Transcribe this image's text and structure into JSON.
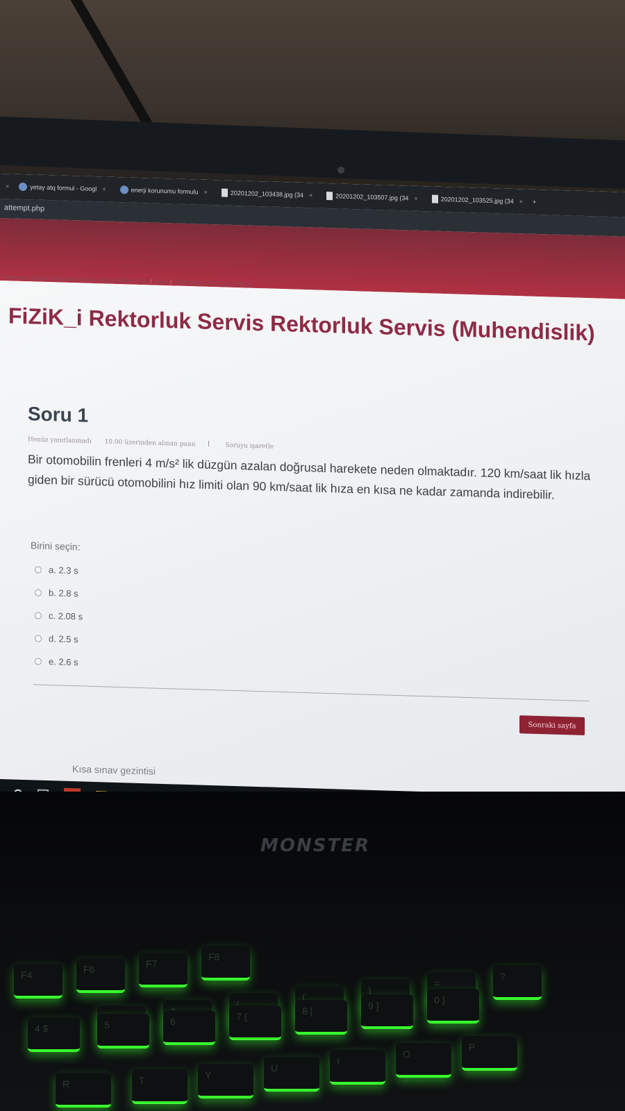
{
  "browser": {
    "tabs": [
      {
        "label": "yetay atq formul - Googl",
        "icon": "google-icon"
      },
      {
        "label": "enerji korunumu formulu",
        "icon": "google-icon"
      },
      {
        "label": "20201202_103438.jpg (34",
        "icon": "file-icon"
      },
      {
        "label": "20201202_103507.jpg (34",
        "icon": "file-icon"
      },
      {
        "label": "20201202_103525.jpg (34",
        "icon": "file-icon"
      }
    ],
    "new_tab_label": "+",
    "url": "attempt.php"
  },
  "page": {
    "breadcrumb": [
      "Rektorluk Servis Rektorluk Servis (Muhendislik) (10)",
      "Giriş",
      "ARASINAV (FIZ111 FIZIK-I)"
    ],
    "breadcrumb_separator": "/",
    "course_title": "FiZiK_i Rektorluk Servis Rektorluk Servis (Muhendislik)"
  },
  "question": {
    "title": "Soru 1",
    "status": "Henüz yanıtlanmadı",
    "points": "10.00 üzerinden alınan puan",
    "flag_label": "Soruyu işaretle",
    "text": "Bir otomobilin frenleri 4 m/s² lik düzgün azalan doğrusal harekete neden olmaktadır. 120 km/saat lik hızla giden bir sürücü otomobilini hız limiti olan 90 km/saat lik hıza en kısa ne kadar zamanda indirebilir.",
    "answer_prompt": "Birini seçin:",
    "options": [
      "a. 2.3 s",
      "b. 2.8 s",
      "c. 2.08 s",
      "d. 2.5 s",
      "e. 2.6 s"
    ]
  },
  "navigation": {
    "next_button": "Sonraki sayfa",
    "quiz_navigation": "Kısa sınav gezintisi"
  },
  "device": {
    "brand_logo": "MONSTER",
    "keys": [
      "F4",
      "F6",
      "F7",
      "F8",
      "%",
      "&",
      "/",
      "(",
      ")",
      "=",
      "?",
      "4 $",
      "5",
      "6",
      "7 {",
      "8 [",
      "9 ]",
      "0 }",
      "T",
      "Y",
      "U",
      "I",
      "O",
      "P",
      "R"
    ]
  },
  "colors": {
    "accent": "#8e2b46",
    "banner": "#b03143",
    "button": "#8e2233",
    "keyboard_glow": "#39ff2e"
  }
}
